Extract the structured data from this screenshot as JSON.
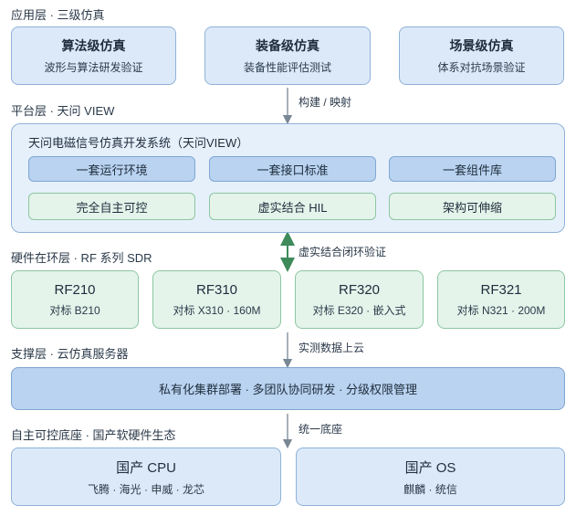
{
  "layers": {
    "app": {
      "label": "应用层 · 三级仿真",
      "boxes": [
        {
          "title": "算法级仿真",
          "sub": "波形与算法研发验证"
        },
        {
          "title": "装备级仿真",
          "sub": "装备性能评估测试"
        },
        {
          "title": "场景级仿真",
          "sub": "体系对抗场景验证"
        }
      ]
    },
    "arrow1": "构建 / 映射",
    "platform": {
      "label": "平台层 · 天问 VIEW",
      "title": "天问电磁信号仿真开发系统（天问VIEW）",
      "row1": [
        "一套运行环境",
        "一套接口标准",
        "一套组件库"
      ],
      "row2": [
        "完全自主可控",
        "虚实结合 HIL",
        "架构可伸缩"
      ]
    },
    "arrow2": "虚实结合闭环验证",
    "hardware": {
      "label": "硬件在环层 · RF 系列 SDR",
      "boxes": [
        {
          "title": "RF210",
          "sub": "对标 B210"
        },
        {
          "title": "RF310",
          "sub": "对标 X310 · 160M"
        },
        {
          "title": "RF320",
          "sub": "对标 E320 · 嵌入式"
        },
        {
          "title": "RF321",
          "sub": "对标 N321 · 200M"
        }
      ]
    },
    "arrow3": "实测数据上云",
    "support": {
      "label": "支撑层 · 云仿真服务器",
      "bar": "私有化集群部署 · 多团队协同研发 · 分级权限管理"
    },
    "arrow4": "统一底座",
    "base": {
      "label": "自主可控底座 · 国产软硬件生态",
      "boxes": [
        {
          "title": "国产 CPU",
          "sub": "飞腾 · 海光 · 申威 · 龙芯"
        },
        {
          "title": "国产 OS",
          "sub": "麒麟 · 统信"
        }
      ]
    }
  }
}
